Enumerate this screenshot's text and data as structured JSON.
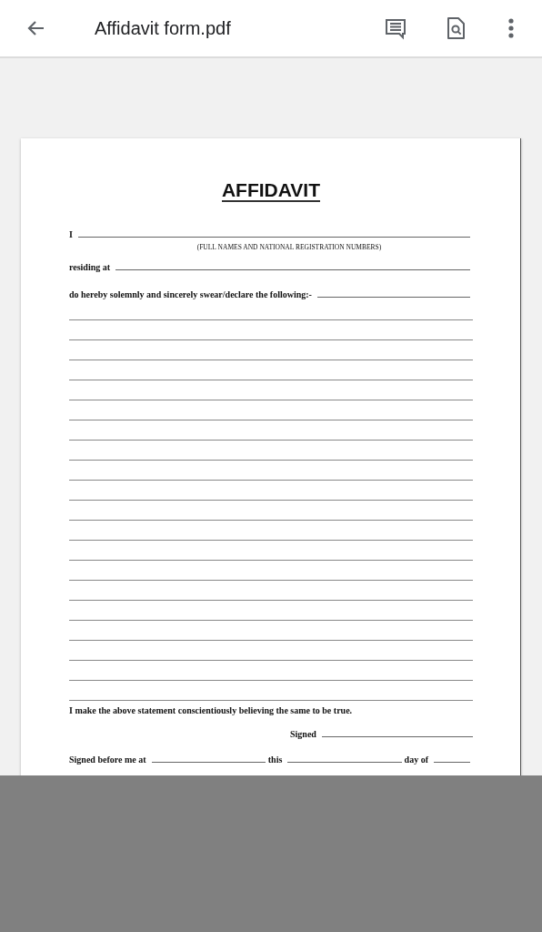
{
  "toolbar": {
    "title": "Affidavit form.pdf"
  },
  "document": {
    "title": "AFFIDAVIT",
    "name_label": "I",
    "name_caption": "(FULL NAMES AND NATIONAL REGISTRATION NUMBERS)",
    "residence_label": "residing at",
    "declaration_label": "do hereby solemnly and sincerely swear/declare the following:-",
    "statement": "I make the above statement conscientiously believing the same to be true.",
    "signed_label": "Signed",
    "witness_line": [
      "Signed before me at",
      "this",
      "day of"
    ]
  }
}
